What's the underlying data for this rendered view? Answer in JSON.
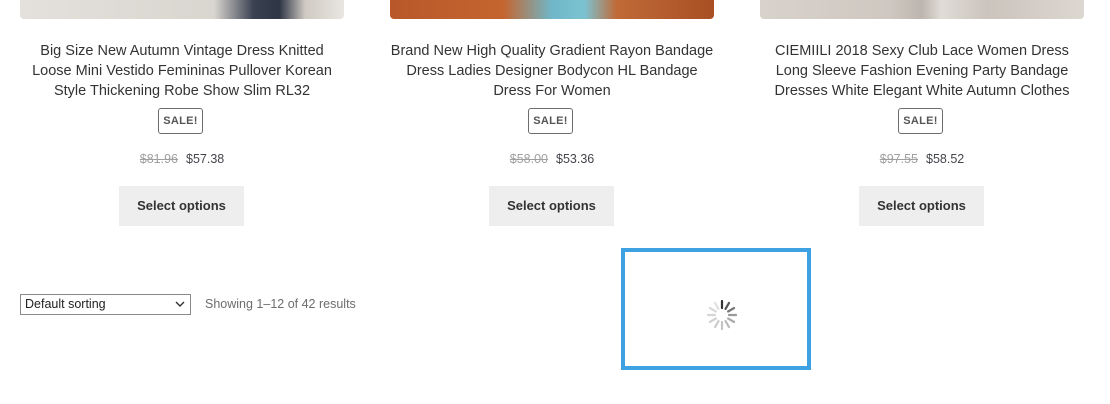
{
  "products": [
    {
      "title": "Big Size New Autumn Vintage Dress Knitted Loose Mini Vestido Femininas Pullover Korean Style Thickening Robe Show Slim RL32",
      "badge": "SALE!",
      "old_price": "$81.96",
      "price": "$57.38",
      "button": "Select options"
    },
    {
      "title": "Brand New High Quality Gradient Rayon Bandage Dress Ladies Designer Bodycon HL Bandage Dress For Women",
      "badge": "SALE!",
      "old_price": "$58.00",
      "price": "$53.36",
      "button": "Select options"
    },
    {
      "title": "CIEMIILI 2018 Sexy Club Lace Women Dress Long Sleeve Fashion Evening Party Bandage Dresses White Elegant White Autumn Clothes",
      "badge": "SALE!",
      "old_price": "$97.55",
      "price": "$58.52",
      "button": "Select options"
    }
  ],
  "toolbar": {
    "sorting_selected": "Default sorting",
    "result_count": "Showing 1–12 of 42 results"
  },
  "colors": {
    "loader_border": "#3da1e2",
    "button_bg": "#eeeeee"
  },
  "icons": {
    "loader": "loading-spinner-icon",
    "dropdown": "chevron-down-icon"
  }
}
